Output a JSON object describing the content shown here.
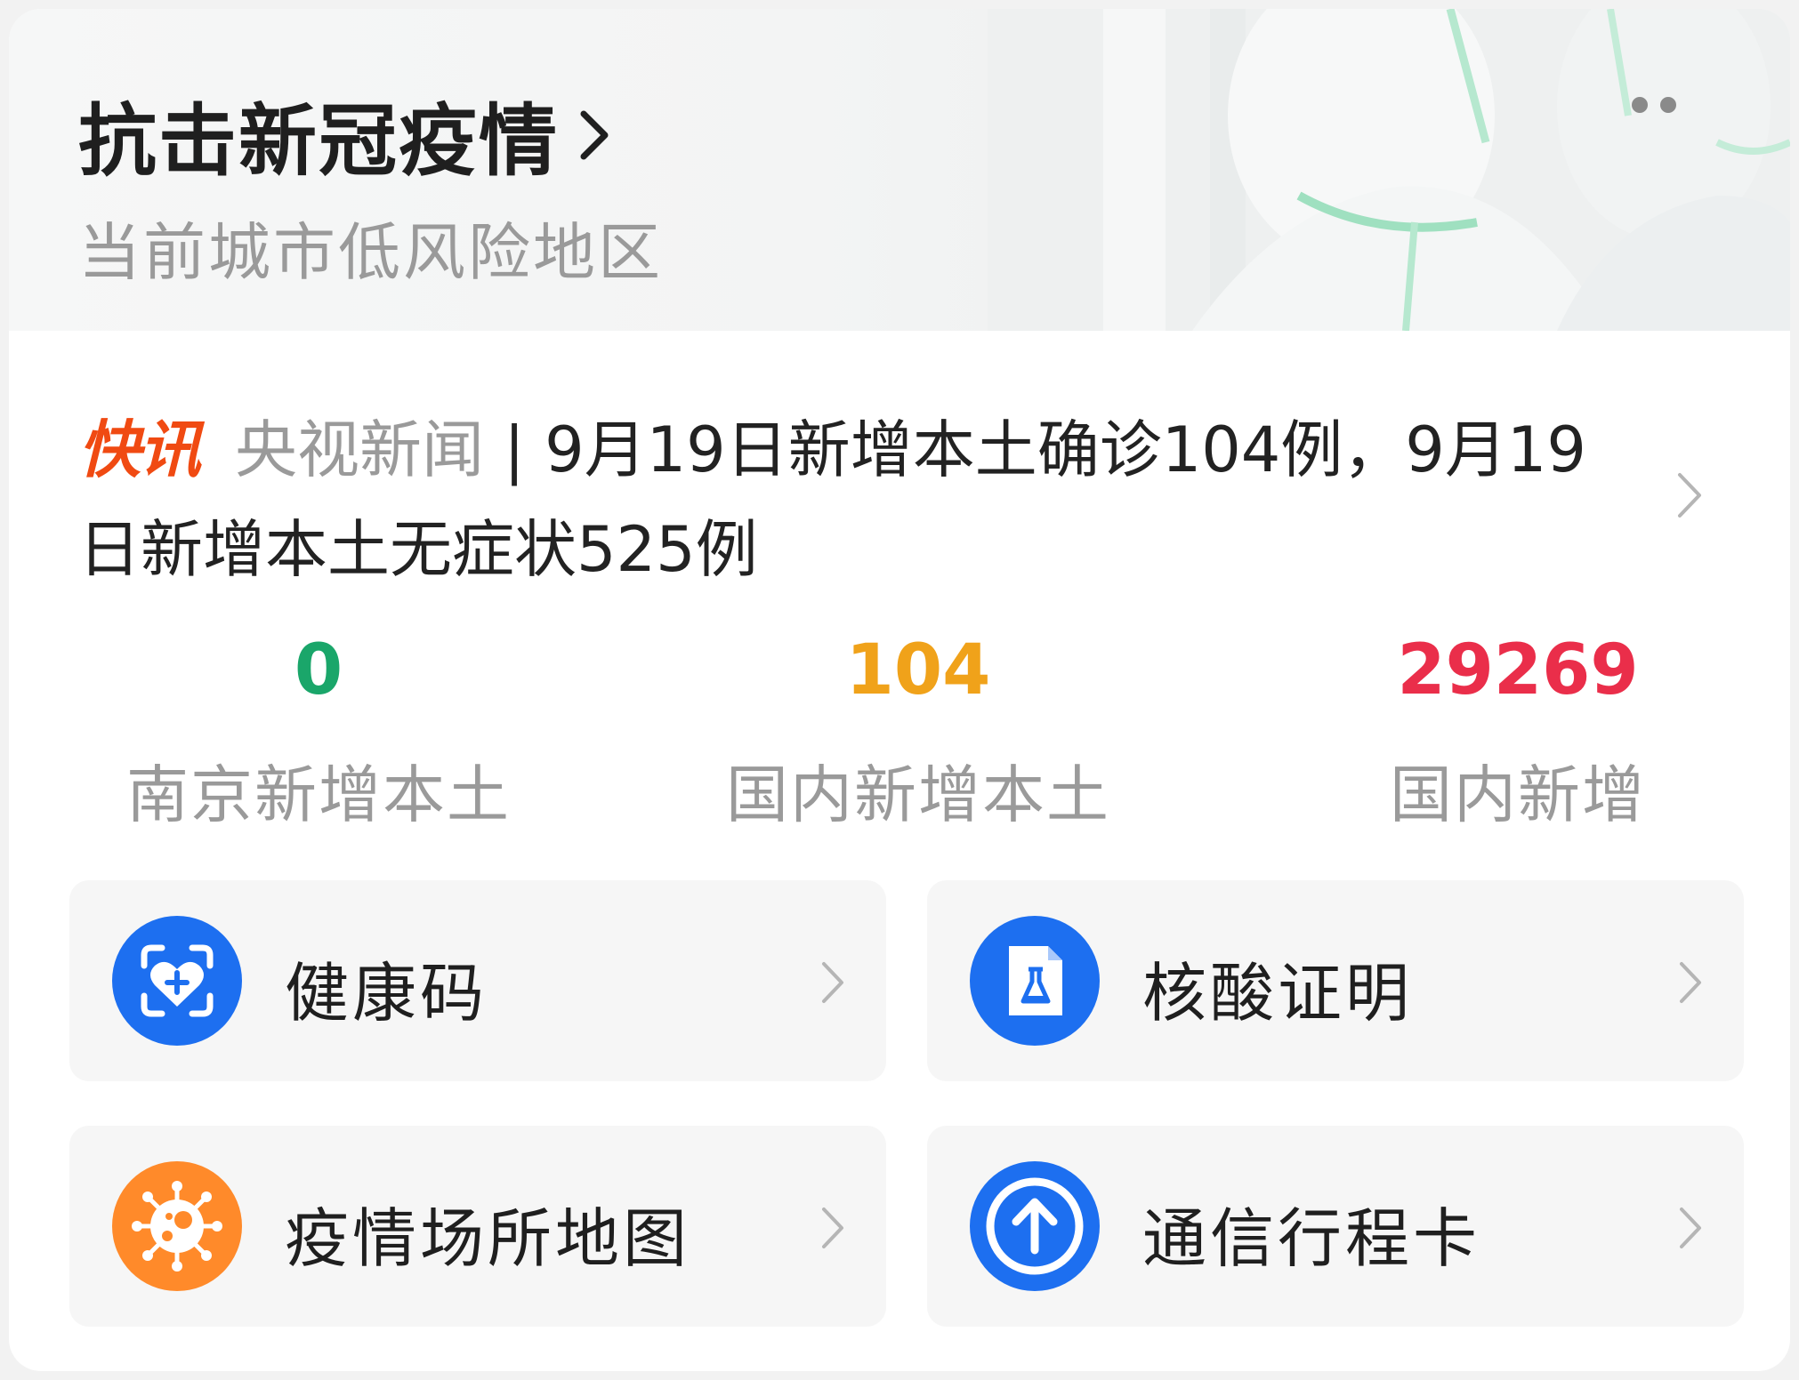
{
  "header": {
    "title": "抗击新冠疫情",
    "subtitle": "当前城市低风险地区"
  },
  "news": {
    "tag": "快讯",
    "source": "央视新闻",
    "separator": " | ",
    "text": "9月19日新增本土确诊104例，9月19日新增本土无症状525例"
  },
  "stats": [
    {
      "value": "0",
      "label": "南京新增本土",
      "color": "#1aa66a"
    },
    {
      "value": "104",
      "label": "国内新增本土",
      "color": "#f0a21a"
    },
    {
      "value": "29269",
      "label": "国内新增",
      "color": "#ea2e4a"
    }
  ],
  "tiles": [
    {
      "label": "健康码",
      "icon": "health-code-icon",
      "color": "#1d6ff0"
    },
    {
      "label": "核酸证明",
      "icon": "nucleic-acid-certificate-icon",
      "color": "#1d6ff0"
    },
    {
      "label": "疫情场所地图",
      "icon": "virus-map-icon",
      "color": "#ff8a2a"
    },
    {
      "label": "通信行程卡",
      "icon": "travel-card-icon",
      "color": "#1d6ff0"
    }
  ]
}
